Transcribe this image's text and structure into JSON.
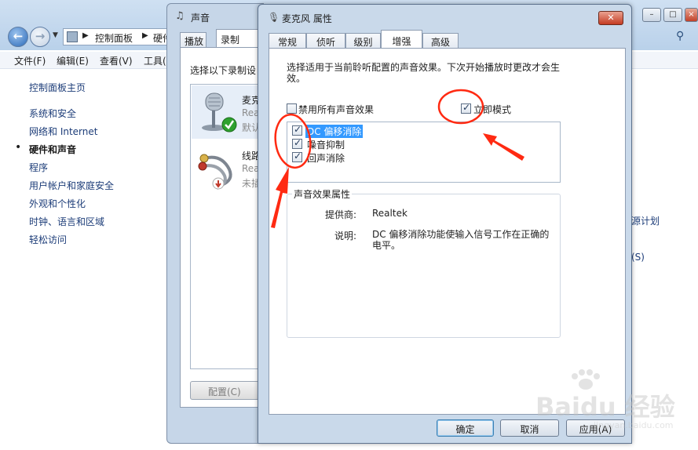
{
  "control_panel": {
    "breadcrumb": [
      "控制面板",
      "硬件"
    ],
    "menu": [
      "文件(F)",
      "编辑(E)",
      "查看(V)",
      "工具("
    ],
    "home_link": "控制面板主页",
    "categories": [
      "系统和安全",
      "网络和 Internet",
      "硬件和声音",
      "程序",
      "用户帐户和家庭安全",
      "外观和个性化",
      "时钟、语言和区域",
      "轻松访问"
    ],
    "selected_category": "硬件和声音",
    "right_fragments": [
      "源计划",
      "(S)"
    ]
  },
  "sound_dialog": {
    "title": "声音",
    "tabs": [
      "播放",
      "录制"
    ],
    "active_tab": "录制",
    "description": "选择以下录制设",
    "devices": [
      {
        "name": "麦克",
        "sub": "Rea",
        "status": "默认",
        "status_icon": "green-check-icon"
      },
      {
        "name": "线路",
        "sub": "Rea",
        "status": "未插",
        "status_icon": "red-down-arrow-icon"
      }
    ],
    "configure_button": "配置(C)"
  },
  "mic_dialog": {
    "title": "麦克风 属性",
    "tabs": [
      "常规",
      "侦听",
      "级别",
      "增强",
      "高级"
    ],
    "active_tab": "增强",
    "description": "选择适用于当前聆听配置的声音效果。下次开始播放时更改才会生效。",
    "disable_all": {
      "label": "禁用所有声音效果",
      "checked": false
    },
    "immediate_mode": {
      "label": "立即模式",
      "checked": true
    },
    "enhancements": [
      {
        "label": "DC 偏移消除",
        "checked": true,
        "selected": true
      },
      {
        "label": "噪音抑制",
        "checked": true,
        "selected": false
      },
      {
        "label": "回声消除",
        "checked": true,
        "selected": false
      }
    ],
    "properties": {
      "title": "声音效果属性",
      "provider_label": "提供商:",
      "provider_value": "Realtek",
      "description_label": "说明:",
      "description_value": "DC 偏移消除功能使输入信号工作在正确的电平。"
    },
    "buttons": {
      "ok": "确定",
      "cancel": "取消",
      "apply": "应用(A)"
    }
  },
  "annotation_color": "#ff2a12",
  "watermark": {
    "text": "Baidu 经验",
    "site": "jingyan.baidu.com"
  }
}
